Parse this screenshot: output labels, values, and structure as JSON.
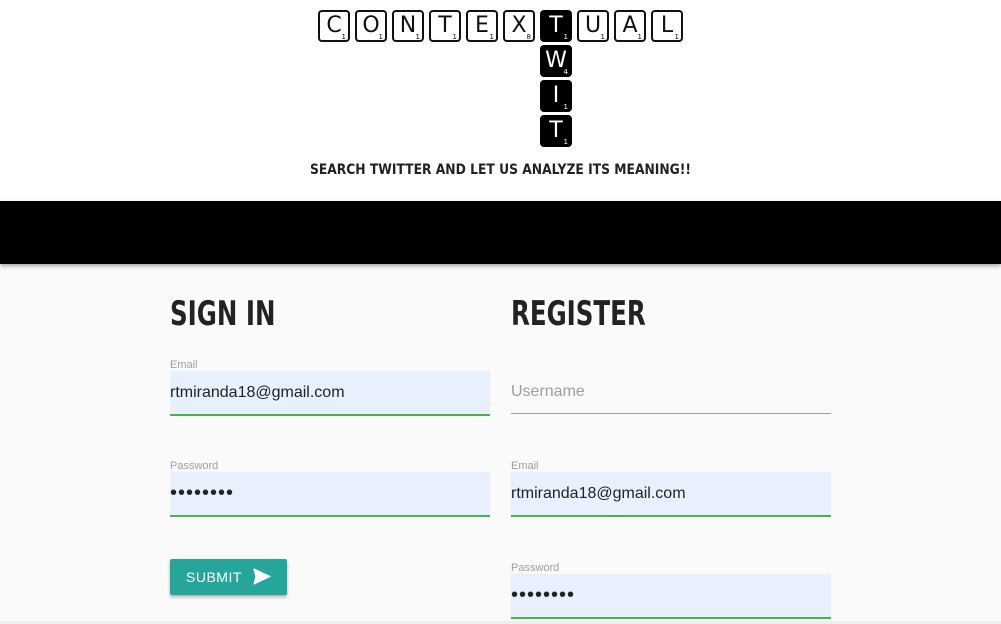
{
  "header": {
    "logo_word_across": [
      "C",
      "O",
      "N",
      "T",
      "E",
      "X",
      "T",
      "U",
      "A",
      "L"
    ],
    "logo_word_down": [
      "W",
      "I",
      "T"
    ],
    "tile_point": "1",
    "tile_point_x": "8",
    "tile_point_w": "4",
    "tagline": "SEARCH TWITTER AND LET US ANALYZE ITS MEANING!!"
  },
  "signin": {
    "heading": "SIGN IN",
    "email_label": "Email",
    "email_value": "rtmiranda18@gmail.com",
    "password_label": "Password",
    "password_value": "••••••••",
    "submit_label": "SUBMIT"
  },
  "register": {
    "heading": "REGISTER",
    "username_placeholder": "Username",
    "email_label": "Email",
    "email_value": "rtmiranda18@gmail.com",
    "password_label": "Password",
    "password_value": "••••••••"
  },
  "colors": {
    "submit_bg": "#26a69a",
    "field_active_line": "#4caf50",
    "autofill_bg": "#e8f0fe",
    "band": "#000000"
  }
}
